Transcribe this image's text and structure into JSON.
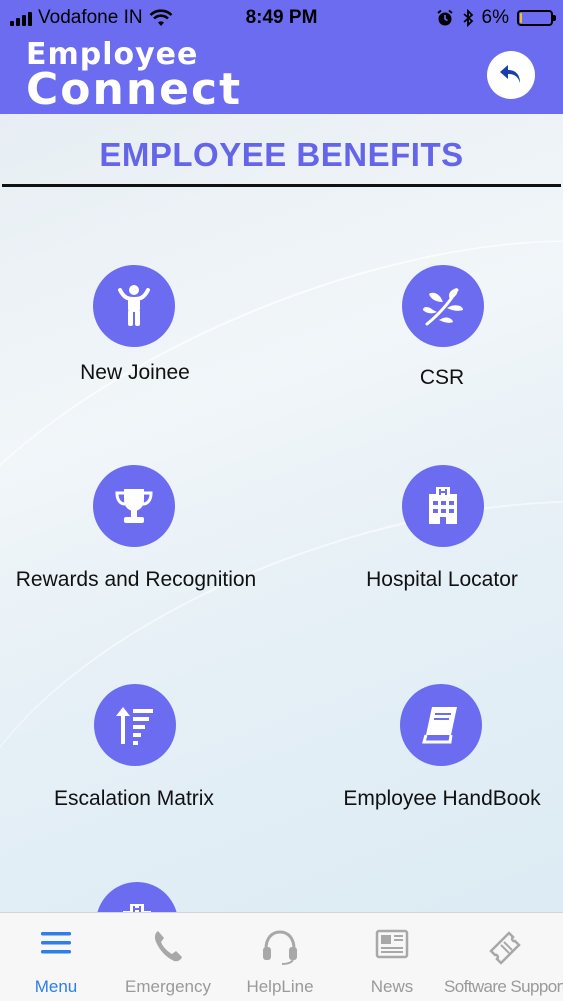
{
  "status_bar": {
    "carrier": "Vodafone IN",
    "time": "8:49 PM",
    "battery": "6%",
    "battery_level": 0.06
  },
  "header": {
    "logo_line1": "Employee",
    "logo_line2": "Connect",
    "back_icon": "undo-arrow-icon"
  },
  "page": {
    "title": "EMPLOYEE BENEFITS"
  },
  "tiles": [
    {
      "label": "New Joinee",
      "icon": "person-icon"
    },
    {
      "label": "CSR",
      "icon": "leaf-icon"
    },
    {
      "label": "Rewards and Recognition",
      "icon": "trophy-icon"
    },
    {
      "label": "Hospital Locator",
      "icon": "hospital-icon"
    },
    {
      "label": "Escalation Matrix",
      "icon": "escalation-icon"
    },
    {
      "label": "Employee HandBook",
      "icon": "book-icon"
    }
  ],
  "tab_bar": {
    "items": [
      {
        "label": "Menu",
        "icon": "menu-icon",
        "active": true
      },
      {
        "label": "Emergency",
        "icon": "phone-icon",
        "active": false
      },
      {
        "label": "HelpLine",
        "icon": "headset-icon",
        "active": false
      },
      {
        "label": "News",
        "icon": "newspaper-icon",
        "active": false
      },
      {
        "label": "Software Support",
        "icon": "ticket-icon",
        "active": false
      }
    ]
  },
  "colors": {
    "brand": "#6c6cf0",
    "title": "#6565ea",
    "tab_active": "#2d7ee6",
    "tab_inactive": "#9a9a9a"
  }
}
